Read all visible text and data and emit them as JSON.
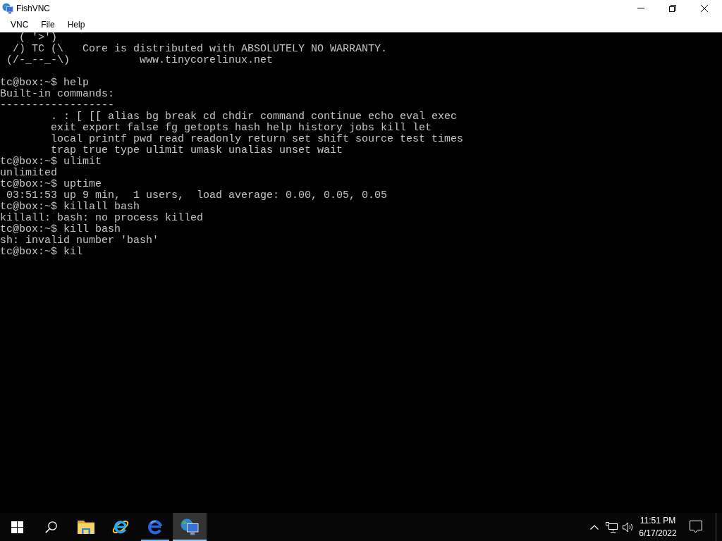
{
  "window": {
    "title": "FishVNC",
    "maximized": true
  },
  "menu_bar": [
    "VNC",
    "File",
    "Help"
  ],
  "terminal": {
    "blocks": [
      [
        "   ( '>')",
        "  /) TC (\\   Core is distributed with ABSOLUTELY NO WARRANTY.",
        " (/-_--_-\\)           www.tinycorelinux.net"
      ],
      [
        "tc@box:~$ help",
        "Built-in commands:",
        "------------------",
        "        . : [ [[ alias bg break cd chdir command continue echo eval exec",
        "        exit export false fg getopts hash help history jobs kill let",
        "        local printf pwd read readonly return set shift source test times",
        "        trap true type ulimit umask unalias unset wait",
        "tc@box:~$ ulimit",
        "unlimited",
        "tc@box:~$ uptime",
        " 03:51:53 up 9 min,  1 users,  load average: 0.00, 0.05, 0.05",
        "tc@box:~$ killall bash",
        "killall: bash: no process killed",
        "tc@box:~$ kill bash",
        "sh: invalid number 'bash'",
        "tc@box:~$ kil"
      ]
    ]
  },
  "taskbar": {
    "apps": [
      {
        "running": false,
        "active": false
      },
      {
        "running": false,
        "active": false
      },
      {
        "running": true,
        "active": false
      },
      {
        "running": true,
        "active": true
      }
    ],
    "clock": {
      "time": "11:51 PM",
      "date": "6/17/2022"
    }
  }
}
